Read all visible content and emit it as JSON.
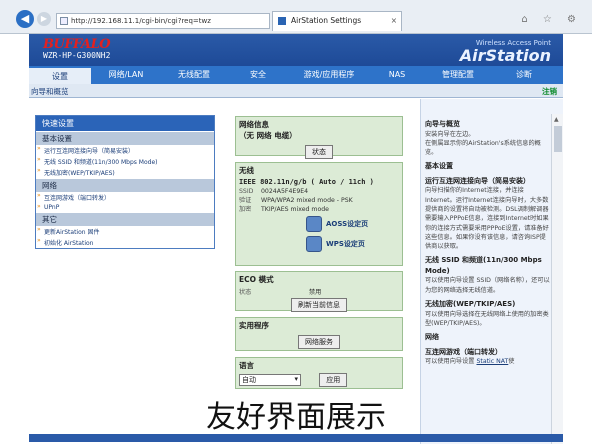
{
  "browser": {
    "url": "http://192.168.11.1/cgi-bin/cgi?req=twz",
    "tab_title": "AirStation Settings",
    "window_tools": "⌂ ☆ ⚙"
  },
  "header": {
    "logo": "BUFFALO",
    "model": "WZR-HP-G300NH2",
    "brand_small": "Wireless Access Point",
    "brand_big": "AirStation"
  },
  "nav": {
    "items": [
      {
        "label": "设置"
      },
      {
        "label": "网络/LAN"
      },
      {
        "label": "无线配置"
      },
      {
        "label": "安全"
      },
      {
        "label": "游戏/应用程序"
      },
      {
        "label": "NAS"
      },
      {
        "label": "管理配置"
      },
      {
        "label": "诊断"
      }
    ]
  },
  "subnav": {
    "left": "向导和概览",
    "right": "注销"
  },
  "left_panel": {
    "title": "快速设置",
    "sections": [
      {
        "name": "基本设置",
        "links": [
          "运行互连网连接向导（简易安装）",
          "无线 SSID 和频道(11n/300 Mbps Mode)",
          "无线加密(WEP/TKIP/AES)"
        ]
      },
      {
        "name": "网络",
        "links": [
          "互连网游戏（端口转发）",
          "UPnP"
        ]
      },
      {
        "name": "其它",
        "links": [
          "更新AirStation 固件",
          "初始化 AirStation"
        ]
      }
    ]
  },
  "net_info": {
    "title": "网络信息",
    "status_line": "（无 网络 电缆）",
    "button": "状态"
  },
  "wireless": {
    "title": "无线",
    "mode": "IEEE 802.11n/g/b ( Auto / 11ch )",
    "rows": [
      {
        "k": "SSID",
        "v": "0024A5F4E9E4"
      },
      {
        "k": "验证",
        "v": "WPA/WPA2 mixed mode - PSK"
      },
      {
        "k": "加密",
        "v": "TKIP/AES mixed mode"
      }
    ],
    "aoss": "AOSS设定页",
    "wps": "WPS设定页"
  },
  "eco": {
    "title": "ECO 模式",
    "k": "状态",
    "v": "禁用",
    "button": "刷新当前信息"
  },
  "apps": {
    "title": "实用程序",
    "button": "网络服务"
  },
  "lang": {
    "title": "语言",
    "value": "自动",
    "button": "应用"
  },
  "help": {
    "title": "向导与概览",
    "p1": "安装向导在左边。",
    "p2": "在侧属显示你的AirStation's系统信息的概览。",
    "h_basic": "基本设置",
    "h_wizard": "运行互连网连接向导（简易安装）",
    "p_wizard": "向导扫描你的Internet连接，并连接Internet。运行Internet连接向导时，大多数提供商的设置将自动被检测。DSL调制解调器需要输入PPPoE信息，连接到Internet时如果你的连接方式需要采用PPPoE设置，请准备好这些信息。如果你没有该信息，请咨询ISP提供商以获取。",
    "h_ssid": "无线 SSID 和频道(11n/300 Mbps Mode)",
    "p_ssid": "可以使用向导设置 SSID（网络名称），还可以为您的网络选择无线信道。",
    "h_enc": "无线加密(WEP/TKIP/AES)",
    "p_enc": "可以使用向导选择在无线网络上使用的加密类型(WEP/TKIP/AES)。",
    "h_net": "网络",
    "h_game": "互连网游戏（端口转发）",
    "p_game": "可以使用向导设置",
    "p_game_link": "Static NAT",
    "p_game_tail": "使"
  },
  "caption": "友好界面展示"
}
